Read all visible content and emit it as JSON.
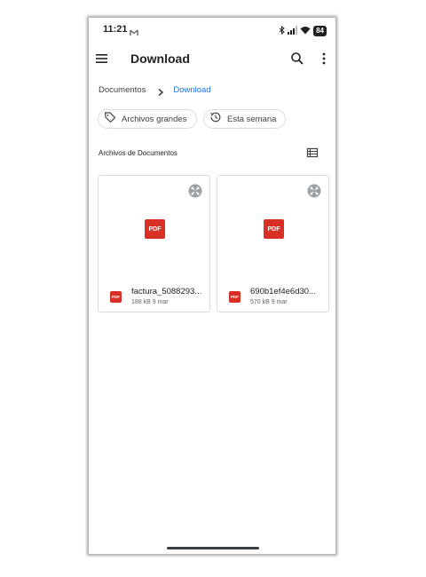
{
  "status_bar": {
    "time": "11:21",
    "battery": "84",
    "icons": [
      "gmail-icon",
      "bluetooth-icon",
      "signal-icon",
      "wifi-icon",
      "battery-icon"
    ]
  },
  "app_bar": {
    "title": "Download",
    "icons": [
      "menu-icon",
      "search-icon",
      "more-vert-icon"
    ]
  },
  "breadcrumb": {
    "parent": "Documentos",
    "current": "Download",
    "current_color": "#1a73e8"
  },
  "filters": {
    "large_files": "Archivos grandes",
    "this_week": "Esta semana"
  },
  "section": {
    "title": "Archivos de Documentos"
  },
  "files": [
    {
      "name": "factura_5088293...",
      "size": "188 kB",
      "date": "9 mar",
      "meta": "188 kB  9 mar",
      "type_label": "PDF"
    },
    {
      "name": "690b1ef4e6d30...",
      "size": "570 kB",
      "date": "9 mar",
      "meta": "570 kB  9 mar",
      "type_label": "PDF"
    }
  ],
  "colors": {
    "pdf_red": "#d93025",
    "accent_blue": "#1a73e8",
    "text_primary": "#202124"
  }
}
